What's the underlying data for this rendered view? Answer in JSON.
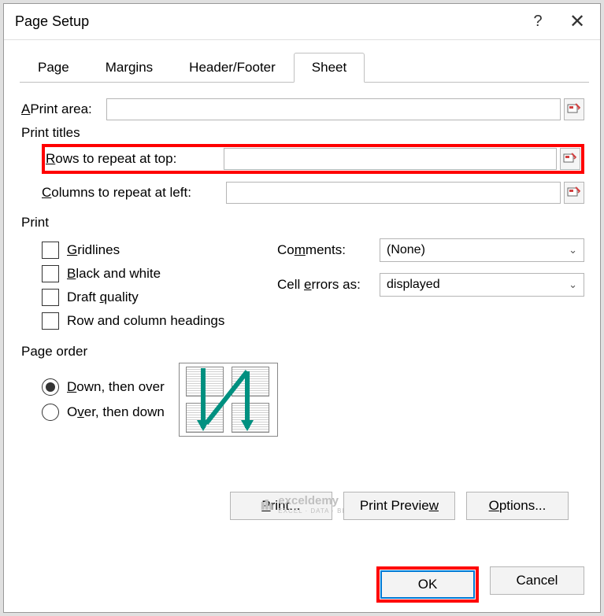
{
  "title": "Page Setup",
  "tabs": {
    "page": "Page",
    "margins": "Margins",
    "headerfooter": "Header/Footer",
    "sheet": "Sheet"
  },
  "print_area_label": "Print area:",
  "print_titles": "Print titles",
  "rows_repeat_label": "Rows to repeat at top:",
  "cols_repeat_label": "Columns to repeat at left:",
  "print_section": "Print",
  "gridlines": "Gridlines",
  "blackwhite": "Black and white",
  "draft": "Draft quality",
  "rowcolhead": "Row and column headings",
  "comments_label": "Comments:",
  "comments_value": "(None)",
  "errors_label": "Cell errors as:",
  "errors_value": "displayed",
  "page_order": "Page order",
  "down_over": "Down, then over",
  "over_down": "Over, then down",
  "print_btn": "Print...",
  "preview_btn": "Print Preview",
  "options_btn": "Options...",
  "ok": "OK",
  "cancel": "Cancel",
  "watermark_brand": "exceldemy",
  "watermark_sub": "EXCEL · DATA · BI"
}
